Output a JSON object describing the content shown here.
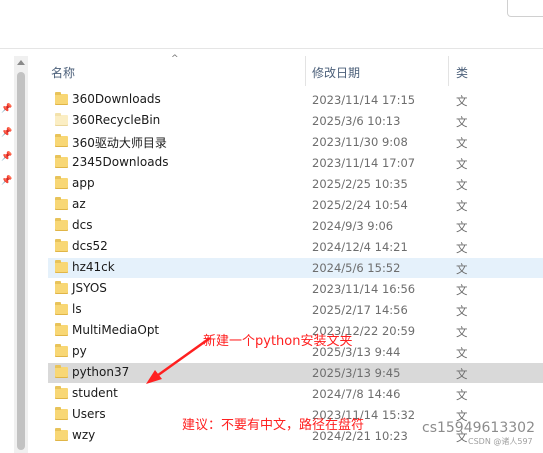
{
  "header": {
    "col_name": "名称",
    "col_date": "修改日期",
    "col_type": "类"
  },
  "files": [
    {
      "name": "360Downloads",
      "date": "2023/11/14 17:15",
      "type": "文",
      "pale": false,
      "state": ""
    },
    {
      "name": "360RecycleBin",
      "date": "2025/3/6 10:13",
      "type": "文",
      "pale": true,
      "state": ""
    },
    {
      "name": "360驱动大师目录",
      "date": "2023/11/30 9:08",
      "type": "文",
      "pale": false,
      "state": ""
    },
    {
      "name": "2345Downloads",
      "date": "2023/11/14 17:07",
      "type": "文",
      "pale": false,
      "state": ""
    },
    {
      "name": "app",
      "date": "2025/2/25 10:35",
      "type": "文",
      "pale": false,
      "state": ""
    },
    {
      "name": "az",
      "date": "2025/2/24 10:54",
      "type": "文",
      "pale": false,
      "state": ""
    },
    {
      "name": "dcs",
      "date": "2024/9/3 9:06",
      "type": "文",
      "pale": false,
      "state": ""
    },
    {
      "name": "dcs52",
      "date": "2024/12/4 14:21",
      "type": "文",
      "pale": false,
      "state": ""
    },
    {
      "name": "hz41ck",
      "date": "2024/5/6 15:52",
      "type": "文",
      "pale": false,
      "state": "hover"
    },
    {
      "name": "JSYOS",
      "date": "2023/11/14 16:56",
      "type": "文",
      "pale": false,
      "state": ""
    },
    {
      "name": "ls",
      "date": "2025/2/17 14:56",
      "type": "文",
      "pale": false,
      "state": ""
    },
    {
      "name": "MultiMediaOpt",
      "date": "2023/12/22 20:59",
      "type": "文",
      "pale": false,
      "state": ""
    },
    {
      "name": "py",
      "date": "2025/3/13 9:44",
      "type": "文",
      "pale": false,
      "state": ""
    },
    {
      "name": "python37",
      "date": "2025/3/13 9:45",
      "type": "文",
      "pale": false,
      "state": "selected"
    },
    {
      "name": "student",
      "date": "2024/7/8 14:46",
      "type": "文",
      "pale": false,
      "state": ""
    },
    {
      "name": "Users",
      "date": "2023/11/14 15:32",
      "type": "文",
      "pale": false,
      "state": ""
    },
    {
      "name": "wzy",
      "date": "2024/2/21 10:23",
      "type": "文",
      "pale": false,
      "state": ""
    }
  ],
  "annotations": {
    "arrow_text": "新建一个python安装文夹",
    "advice_text": "建议：不要有中文，路径在盘符"
  },
  "watermark": {
    "handle": "cs15949613302",
    "csdn": "CSDN @诸人597"
  },
  "colors": {
    "annotation": "#ff2020",
    "folder": "#f8d775",
    "hover": "#e5f1fb",
    "selected": "#d9d9d9"
  },
  "icons": {
    "folder": "folder-icon",
    "pin": "pin-icon",
    "sort": "sort-up-icon"
  }
}
